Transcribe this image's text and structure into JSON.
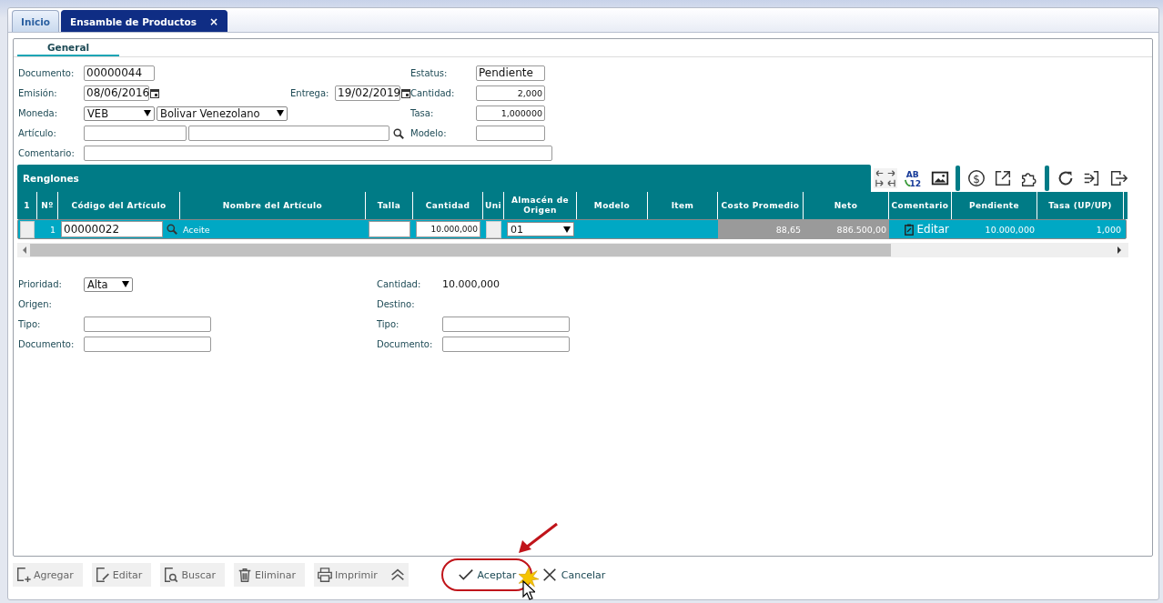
{
  "tabs": [
    {
      "label": "Inicio",
      "selected": false,
      "closable": false
    },
    {
      "label": "Ensamble de Productos",
      "selected": true,
      "closable": true,
      "close": "×"
    }
  ],
  "subtabs": [
    {
      "label": "General",
      "selected": true
    }
  ],
  "header": {
    "documento": {
      "label": "Documento:",
      "value": "00000044"
    },
    "emision": {
      "label": "Emisión:",
      "value": "08/06/2016"
    },
    "entrega": {
      "label": "Entrega:",
      "value": "19/02/2019"
    },
    "moneda": {
      "label": "Moneda:",
      "code": "VEB",
      "name": "Bolivar Venezolano"
    },
    "articulo": {
      "label": "Artículo:"
    },
    "comentario": {
      "label": "Comentario:"
    },
    "estatus": {
      "label": "Estatus:",
      "value": "Pendiente"
    },
    "cantidad": {
      "label": "Cantidad:",
      "value": "2,000"
    },
    "tasa": {
      "label": "Tasa:",
      "value": "1,000000"
    },
    "modelo": {
      "label": "Modelo:"
    }
  },
  "grid": {
    "title": "Renglones",
    "tool_texts": {
      "ab": "AB",
      "digits": "12",
      "currency": "$"
    },
    "columns": [
      "1",
      "Nº",
      "Código del Artículo",
      "Nombre del Artículo",
      "Talla",
      "Cantidad",
      "Uni",
      "Almacén de Origen",
      "Modelo",
      "Item",
      "Costo Promedio",
      "Neto",
      "Comentario",
      "Pendiente",
      "Tasa (UP/UP)"
    ],
    "rows": [
      {
        "selected": true,
        "cells": [
          {
            "kind": "box"
          },
          {
            "kind": "text",
            "text": "1"
          },
          {
            "kind": "lookup",
            "text": "00000022"
          },
          {
            "kind": "label",
            "text": "Aceite"
          },
          {
            "kind": "input"
          },
          {
            "kind": "input",
            "text": "10.000,000"
          },
          {
            "kind": "box"
          },
          {
            "kind": "select",
            "text": "01"
          },
          {
            "kind": "empty"
          },
          {
            "kind": "empty"
          },
          {
            "kind": "shaded",
            "text": "88,65"
          },
          {
            "kind": "shaded",
            "text": "886.500,00"
          },
          {
            "kind": "edit",
            "text": "Editar"
          },
          {
            "kind": "text",
            "text": "10.000,000"
          },
          {
            "kind": "text",
            "text": "1,000"
          }
        ]
      }
    ]
  },
  "footer": {
    "prioridad": {
      "label": "Prioridad:",
      "value": "Alta"
    },
    "origen": {
      "label": "Origen:"
    },
    "destino": {
      "label": "Destino:"
    },
    "cantidad": {
      "label": "Cantidad:",
      "value": "10.000,000"
    },
    "left": [
      {
        "label": "Tipo:"
      },
      {
        "label": "Documento:"
      }
    ],
    "right": [
      {
        "label": "Tipo:"
      },
      {
        "label": "Documento:"
      }
    ]
  },
  "actions": [
    {
      "label": "Agregar",
      "kind": "tool"
    },
    {
      "label": "Editar",
      "kind": "tool"
    },
    {
      "label": "Buscar",
      "kind": "tool"
    },
    {
      "label": "Eliminar",
      "kind": "tool"
    },
    {
      "label": "Imprimir",
      "kind": "tool"
    },
    {
      "kind": "collapse"
    },
    {
      "label": "Aceptar",
      "kind": "confirm",
      "highlighted": true
    },
    {
      "label": "Cancelar",
      "kind": "cancel"
    }
  ]
}
